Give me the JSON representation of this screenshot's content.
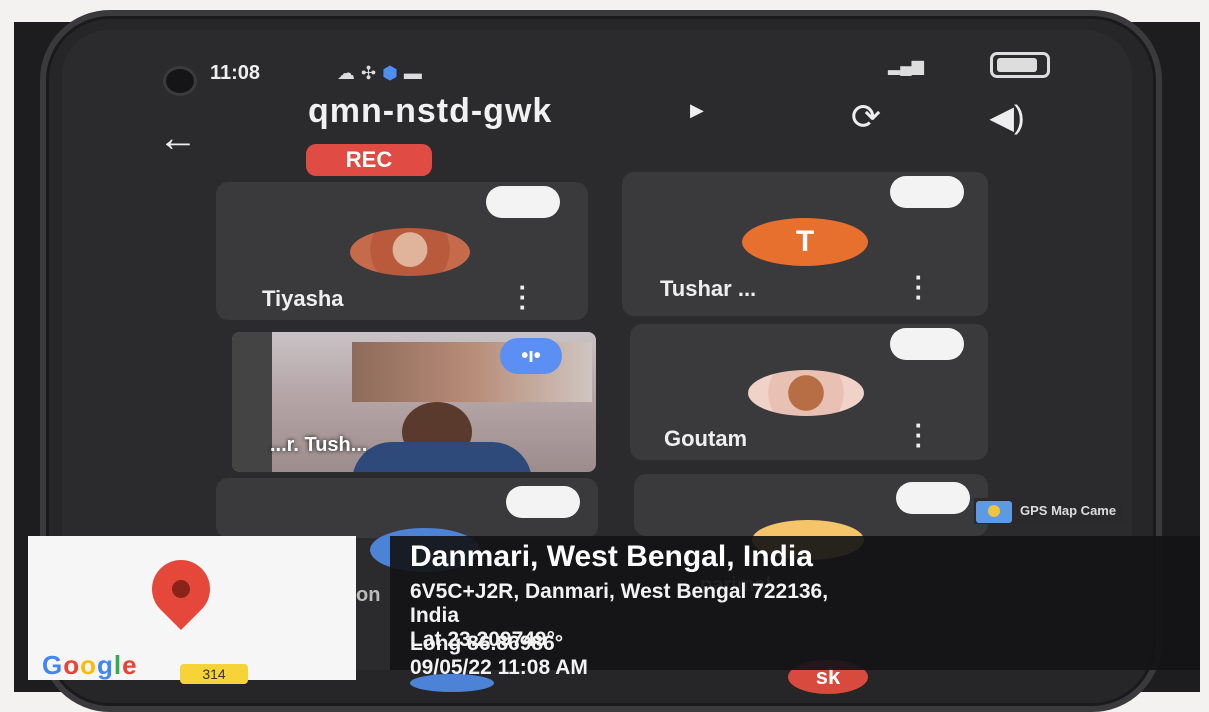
{
  "status": {
    "time": "11:08"
  },
  "header": {
    "meeting_code": "qmn-nstd-gwk",
    "rec_label": "REC"
  },
  "participants": [
    {
      "name": "Tiyasha",
      "initial": ""
    },
    {
      "name": "Tushar ...",
      "initial": "T"
    },
    {
      "name": "Goutam",
      "initial": ""
    },
    {
      "name": "...r. Tush...",
      "initial": ""
    }
  ],
  "partial_names": {
    "left": "on",
    "right": "parimal",
    "bottom_right": "sk"
  },
  "gps": {
    "tag": "GPS Map Came",
    "title": "Danmari, West Bengal, India",
    "address_line1": "6V5C+J2R, Danmari, West Bengal 722136,",
    "address_line2": "India",
    "lat": "Lat 23.209749°",
    "long": "Long 86.86986°",
    "datetime": "09/05/22 11:08 AM",
    "map_brand": "Google",
    "map_badge": "314"
  },
  "colors": {
    "rec": "#e04c43",
    "tushar_avatar": "#e8702f",
    "voice_badge": "#5b8ff3"
  }
}
